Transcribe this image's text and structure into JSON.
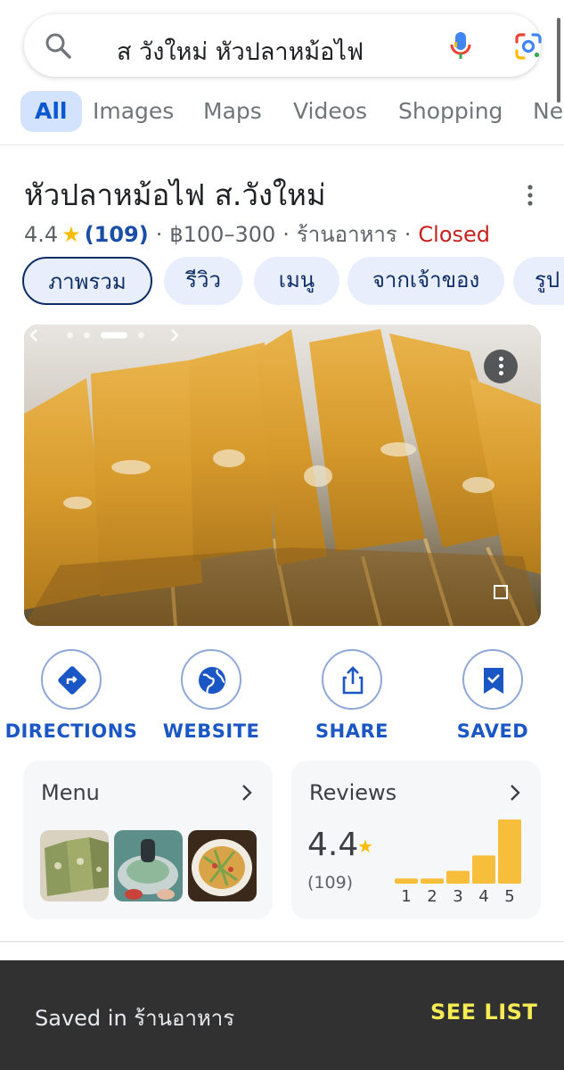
{
  "search": {
    "query": "ส วังใหม่ หัวปลาหม้อไฟ"
  },
  "tabs": [
    {
      "label": "All",
      "active": true
    },
    {
      "label": "Images",
      "active": false
    },
    {
      "label": "Maps",
      "active": false
    },
    {
      "label": "Videos",
      "active": false
    },
    {
      "label": "Shopping",
      "active": false
    },
    {
      "label": "Ne",
      "active": false
    }
  ],
  "place": {
    "title": "หัวปลาหม้อไฟ ส.วังใหม่",
    "rating": "4.4",
    "star": "★",
    "review_count": "(109)",
    "price": "฿100–300",
    "category": "ร้านอาหาร",
    "status": "Closed",
    "separator": "·"
  },
  "chips": [
    {
      "label": "ภาพรวม",
      "selected": true
    },
    {
      "label": "รีวิว",
      "selected": false
    },
    {
      "label": "เมนู",
      "selected": false
    },
    {
      "label": "จากเจ้าของ",
      "selected": false
    },
    {
      "label": "รูป",
      "selected": false
    }
  ],
  "photo": {
    "carousel_pages": 4,
    "carousel_active_index": 2
  },
  "actions": [
    {
      "label": "DIRECTIONS",
      "icon": "directions-icon"
    },
    {
      "label": "WEBSITE",
      "icon": "globe-icon"
    },
    {
      "label": "SHARE",
      "icon": "share-icon"
    },
    {
      "label": "SAVED",
      "icon": "bookmark-check-icon"
    }
  ],
  "menu_card": {
    "title": "Menu"
  },
  "reviews_card": {
    "title": "Reviews",
    "rating": "4.4",
    "star": "★",
    "count": "(109)",
    "distribution": [
      {
        "stars": "1",
        "share": 0.08
      },
      {
        "stars": "2",
        "share": 0.08
      },
      {
        "stars": "3",
        "share": 0.2
      },
      {
        "stars": "4",
        "share": 0.44
      },
      {
        "stars": "5",
        "share": 1.0
      }
    ]
  },
  "snackbar": {
    "message": "Saved in ร้านอาหาร",
    "action_label": "SEE LIST"
  },
  "colors": {
    "accent_blue": "#1a56c4",
    "closed_red": "#c5221f",
    "star_yellow": "#fbbc04",
    "bar_yellow": "#f6be3b",
    "snackbar_action": "#f5ec55"
  }
}
